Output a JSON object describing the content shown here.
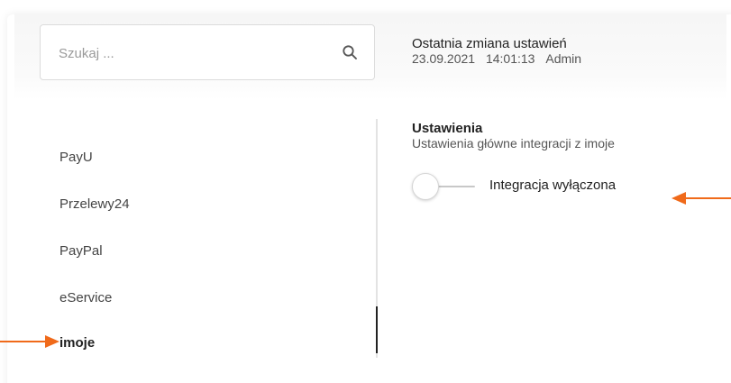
{
  "search": {
    "placeholder": "Szukaj ..."
  },
  "last_change": {
    "title": "Ostatnia zmiana ustawień",
    "date": "23.09.2021",
    "time": "14:01:13",
    "user": "Admin"
  },
  "nav": {
    "items": [
      {
        "label": "PayU",
        "active": false
      },
      {
        "label": "Przelewy24",
        "active": false
      },
      {
        "label": "PayPal",
        "active": false
      },
      {
        "label": "eService",
        "active": false
      },
      {
        "label": "imoje",
        "active": true
      }
    ]
  },
  "settings": {
    "heading": "Ustawienia",
    "description": "Ustawienia główne integracji z imoje",
    "toggle_label": "Integracja wyłączona",
    "toggle_on": false
  },
  "colors": {
    "annotation_arrow": "#f06a1a",
    "active_indicator": "#222222",
    "divider": "#e3e3e3"
  },
  "icons": {
    "search": "search-icon",
    "arrow": "arrow-right-icon"
  }
}
